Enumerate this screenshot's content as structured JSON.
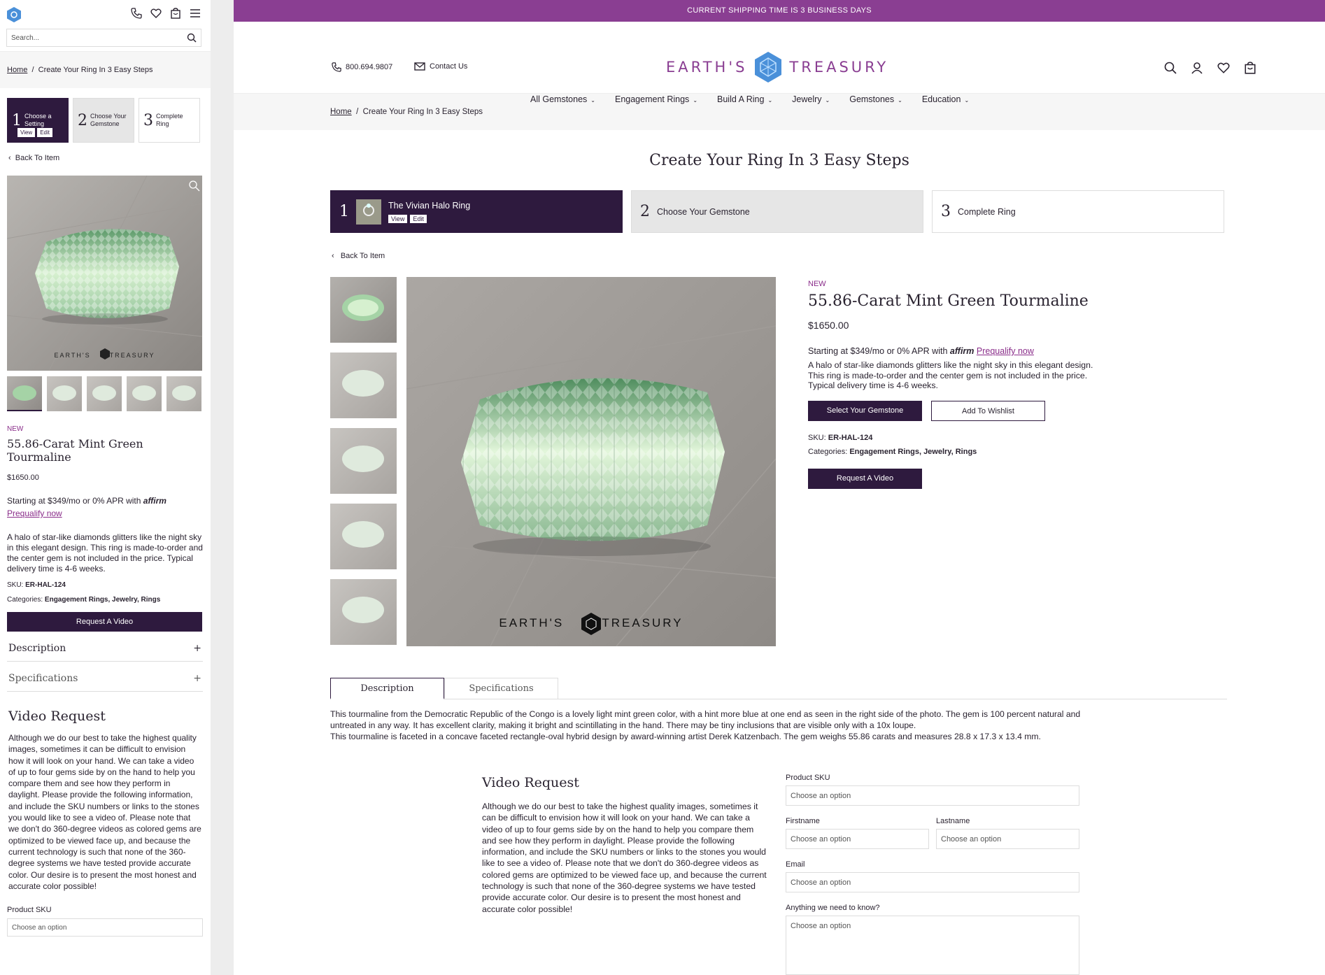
{
  "shipping_banner": "CURRENT SHIPPING TIME IS 3 BUSINESS DAYS",
  "header": {
    "phone": "800.694.9807",
    "contact": "Contact Us",
    "brand_left": "EARTH'S",
    "brand_right": "TREASURY"
  },
  "nav": [
    "All Gemstones",
    "Engagement Rings",
    "Build A Ring",
    "Jewelry",
    "Gemstones",
    "Education"
  ],
  "breadcrumb": {
    "home": "Home",
    "separator": "/",
    "current": "Create Your Ring In 3 Easy Steps"
  },
  "page_title": "Create Your Ring In 3 Easy Steps",
  "steps": [
    {
      "num": "1",
      "label": "The Vivian Halo Ring",
      "mobile_label": "Choose a Setting",
      "view": "View",
      "edit": "Edit"
    },
    {
      "num": "2",
      "label": "Choose Your Gemstone",
      "mobile_label": "Choose Your Gemstone"
    },
    {
      "num": "3",
      "label": "Complete Ring",
      "mobile_label": "Complete Ring"
    }
  ],
  "back": "Back To Item",
  "watermark": {
    "left": "EARTH'S",
    "right": "TREASURY"
  },
  "product": {
    "badge": "NEW",
    "title": "55.86-Carat Mint Green Tourmaline",
    "price": "$1650.00",
    "affirm_prefix": "Starting at $349/mo or 0% APR with",
    "affirm_logo": "affirm",
    "prequalify": "Prequalify now",
    "description": "A halo of star-like diamonds glitters like the night sky in this elegant design. This ring is made-to-order and the center gem is not included in the price. Typical delivery time is 4-6 weeks.",
    "desc_line1": "A halo of star-like diamonds glitters like the night sky in this elegant design.",
    "desc_line2": "This ring is made-to-order and the center gem is not included in the price.",
    "desc_line3": "Typical delivery time is 4-6 weeks.",
    "select_btn": "Select Your Gemstone",
    "wishlist_btn": "Add To Wishlist",
    "sku_label": "SKU:",
    "sku": "ER-HAL-124",
    "categories_label": "Categories:",
    "categories": "Engagement Rings, Jewelry, Rings",
    "video_btn": "Request A Video"
  },
  "tabs": {
    "description": "Description",
    "specifications": "Specifications"
  },
  "tab_text": {
    "line1": "This tourmaline from the Democratic Republic of the Congo is a lovely light mint green color, with a hint more blue at one end as seen in the right side of the photo. The gem is 100 percent natural and",
    "line2": "untreated in any way. It has excellent clarity, making it bright and scintillating in the hand. There may be tiny inclusions that are visible only with a 10x loupe.",
    "line3": "This tourmaline is faceted in a concave faceted rectangle-oval hybrid design by award-winning artist Derek Katzenbach. The gem weighs 55.86 carats and measures 28.8 x 17.3 x 13.4 mm."
  },
  "video_request": {
    "title": "Video Request",
    "text": "Although we do our best to take the highest quality images, sometimes it can be difficult to envision how it will look on your hand. We can take a video of up to four gems side by on the hand to help you compare them and see how they perform in daylight. Please provide the following information, and include the SKU numbers or links to the stones you would like to see a video of. Please note that we don't do 360-degree videos as colored gems are optimized to be viewed face up, and because the current technology is such that none of the 360-degree systems we have tested provide accurate color. Our desire is to present the most honest and accurate color possible!"
  },
  "form": {
    "sku_label": "Product SKU",
    "firstname_label": "Firstname",
    "lastname_label": "Lastname",
    "email_label": "Email",
    "notes_label": "Anything we need to know?",
    "placeholder": "Choose an option"
  },
  "mobile": {
    "search_placeholder": "Search..."
  },
  "colors": {
    "plum": "#2e1a3e",
    "banner": "#8a3e92",
    "accent": "#8a2d8a",
    "logo_blue": "#4a90d9"
  }
}
